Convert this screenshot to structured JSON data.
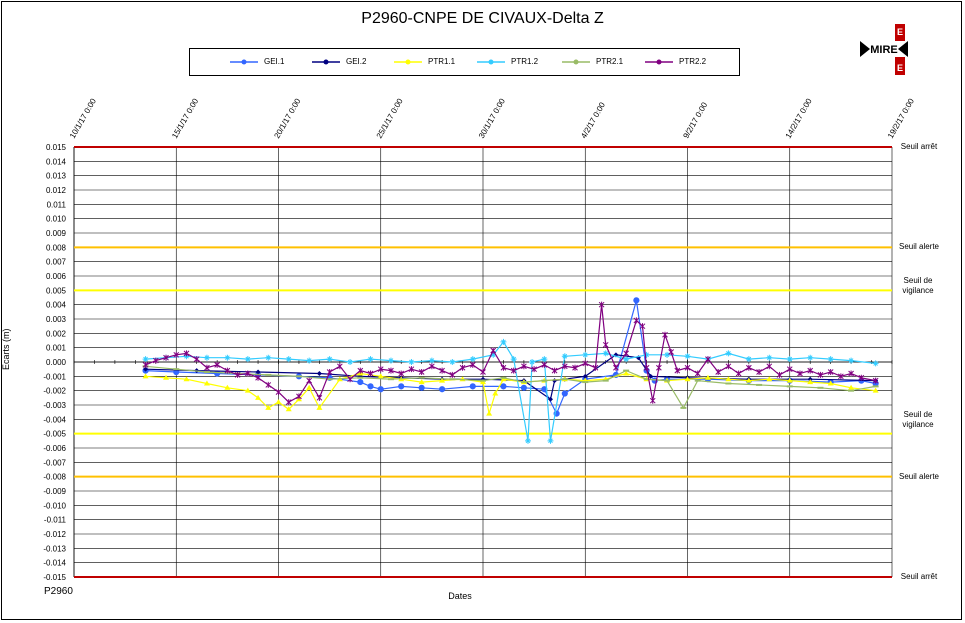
{
  "chart_data": {
    "type": "line",
    "title": "P2960-CNPE DE CIVAUX-Delta Z",
    "xlabel": "Dates",
    "ylabel": "Ecarts (m)",
    "footer": "P2960",
    "xlim": [
      "10/1/17",
      "19/2/17"
    ],
    "ylim": [
      -0.015,
      0.015
    ],
    "x_tick_labels": [
      "10/1/17 0:00",
      "15/1/17 0:00",
      "20/1/17 0:00",
      "25/1/17 0:00",
      "30/1/17 0:00",
      "4/2/17 0:00",
      "9/2/17 0:00",
      "14/2/17 0:00",
      "19/2/17 0:00"
    ],
    "y_tick_labels": [
      "0.015",
      "0.014",
      "0.013",
      "0.012",
      "0.011",
      "0.010",
      "0.009",
      "0.008",
      "0.007",
      "0.006",
      "0.005",
      "0.004",
      "0.003",
      "0.002",
      "0.001",
      "0.000",
      "-0.001",
      "-0.002",
      "-0.003",
      "-0.004",
      "-0.005",
      "-0.006",
      "-0.007",
      "-0.008",
      "-0.009",
      "-0.010",
      "-0.011",
      "-0.012",
      "-0.013",
      "-0.014",
      "-0.015"
    ],
    "grid": true,
    "legend_position": "top",
    "thresholds": [
      {
        "value": 0.015,
        "label": "Seuil arrêt",
        "color": "#c00000"
      },
      {
        "value": 0.008,
        "label": "Seuil alerte",
        "color": "#ffc000"
      },
      {
        "value": 0.005,
        "label": "Seuil de vigilance",
        "color": "#ffff00"
      },
      {
        "value": -0.005,
        "label": "Seuil de vigilance",
        "color": "#ffff00"
      },
      {
        "value": -0.008,
        "label": "Seuil alerte",
        "color": "#ffc000"
      },
      {
        "value": -0.015,
        "label": "Seuil arrêt",
        "color": "#c00000"
      }
    ],
    "series": [
      {
        "name": "GEI.1",
        "color": "#3366ff",
        "marker": "circle",
        "x": [
          13.5,
          15,
          17,
          19,
          21,
          22.5,
          24,
          24.5,
          25,
          26,
          27,
          28,
          29.5,
          31,
          32,
          33,
          33.6,
          34,
          35,
          36.5,
          37.5,
          38,
          38.4,
          39,
          41,
          43,
          45,
          47,
          48.5,
          49.2
        ],
        "y": [
          -0.0006,
          -0.0007,
          -0.0008,
          -0.0009,
          -0.001,
          -0.0011,
          -0.0014,
          -0.0017,
          -0.0019,
          -0.0017,
          -0.0018,
          -0.0019,
          -0.0017,
          -0.0017,
          -0.0018,
          -0.0019,
          -0.0036,
          -0.0022,
          -0.0012,
          -0.0009,
          0.0043,
          -0.0006,
          -0.0013,
          -0.0012,
          -0.0012,
          -0.0013,
          -0.0013,
          -0.0014,
          -0.0013,
          -0.0015
        ]
      },
      {
        "name": "GEI.2",
        "color": "#000080",
        "marker": "diamond",
        "x": [
          13.5,
          16,
          19,
          22,
          24,
          26,
          28,
          30,
          32,
          33.3,
          33.5,
          34,
          35,
          36.5,
          37.6,
          38.2,
          40,
          43,
          46,
          49.2
        ],
        "y": [
          -0.0005,
          -0.0006,
          -0.0007,
          -0.0008,
          -0.001,
          -0.0011,
          -0.0012,
          -0.0012,
          -0.0013,
          -0.0026,
          -0.0013,
          -0.0012,
          -0.001,
          0.0005,
          0.0003,
          -0.001,
          -0.0011,
          -0.0012,
          -0.0012,
          -0.0013
        ]
      },
      {
        "name": "PTR1.1",
        "color": "#ffff00",
        "marker": "triangle",
        "x": [
          13.5,
          14.5,
          15.5,
          16.5,
          17.5,
          18.5,
          19,
          19.5,
          20,
          20.5,
          21,
          21.5,
          22,
          23,
          24,
          25,
          26,
          27,
          28,
          29,
          30,
          30.3,
          30.6,
          31,
          32,
          33,
          34,
          35,
          36,
          37,
          38,
          39,
          40,
          41,
          42,
          43,
          44,
          45,
          46,
          47,
          48,
          49.2
        ],
        "y": [
          -0.001,
          -0.0011,
          -0.0012,
          -0.0015,
          -0.0018,
          -0.002,
          -0.0025,
          -0.0032,
          -0.0028,
          -0.0033,
          -0.0026,
          -0.0018,
          -0.0032,
          -0.0012,
          -0.0008,
          -0.001,
          -0.0012,
          -0.0014,
          -0.0013,
          -0.0012,
          -0.0014,
          -0.0036,
          -0.0022,
          -0.0012,
          -0.0014,
          -0.0013,
          -0.0012,
          -0.0013,
          -0.0012,
          -0.0008,
          -0.0012,
          -0.0013,
          -0.0012,
          -0.0011,
          -0.0012,
          -0.0013,
          -0.0012,
          -0.0013,
          -0.0014,
          -0.0015,
          -0.0018,
          -0.002
        ]
      },
      {
        "name": "PTR1.2",
        "color": "#33ccff",
        "marker": "star",
        "x": [
          13.5,
          14.5,
          15.5,
          16.5,
          17.5,
          18.5,
          19.5,
          20.5,
          21.5,
          22.5,
          23.5,
          24.5,
          25.5,
          26.5,
          27.5,
          28.5,
          29.5,
          30.5,
          31,
          31.5,
          32.2,
          32.4,
          33,
          33.3,
          34,
          35,
          36,
          37,
          38,
          39,
          40,
          41,
          42,
          43,
          44,
          45,
          46,
          47,
          48,
          49.2
        ],
        "y": [
          0.0002,
          0.0003,
          0.0004,
          0.0003,
          0.0003,
          0.0002,
          0.0003,
          0.0002,
          0.0001,
          0.0002,
          0.0,
          0.0002,
          0.0001,
          0.0,
          0.0001,
          0.0,
          0.0002,
          0.0005,
          0.0014,
          0.0002,
          -0.0055,
          0.0,
          0.0002,
          -0.0055,
          0.0004,
          0.0005,
          0.0006,
          0.0002,
          0.0005,
          0.0005,
          0.0004,
          0.0002,
          0.0006,
          0.0002,
          0.0003,
          0.0002,
          0.0003,
          0.0002,
          0.0001,
          -0.0001
        ]
      },
      {
        "name": "PTR2.1",
        "color": "#99bb66",
        "marker": "dash",
        "x": [
          13.5,
          15,
          16.5,
          18,
          19.5,
          21,
          22.5,
          24,
          25.5,
          27,
          28.5,
          30,
          31,
          32,
          33,
          34,
          35,
          36,
          37,
          38,
          39,
          39.8,
          40.5,
          42,
          43.5,
          45,
          46.5,
          48,
          49.2
        ],
        "y": [
          -0.0003,
          -0.0005,
          -0.0007,
          -0.0008,
          -0.0009,
          -0.001,
          -0.0012,
          -0.0011,
          -0.0012,
          -0.0011,
          -0.0012,
          -0.0013,
          -0.0011,
          -0.0014,
          -0.0013,
          -0.0012,
          -0.0014,
          -0.0013,
          -0.0006,
          -0.0012,
          -0.0013,
          -0.0032,
          -0.0013,
          -0.0015,
          -0.0016,
          -0.0017,
          -0.0018,
          -0.002,
          -0.0017
        ]
      },
      {
        "name": "PTR2.2",
        "color": "#800080",
        "marker": "x",
        "x": [
          13.5,
          14,
          14.5,
          15,
          15.5,
          16,
          16.5,
          17,
          17.5,
          18,
          18.5,
          19,
          19.5,
          20,
          20.5,
          21,
          21.5,
          22,
          22.5,
          23,
          23.5,
          24,
          24.5,
          25,
          25.5,
          26,
          26.5,
          27,
          27.5,
          28,
          28.5,
          29,
          29.5,
          30,
          30.5,
          31,
          31.5,
          32,
          32.5,
          33,
          33.5,
          34,
          34.5,
          35,
          35.5,
          35.8,
          36,
          36.5,
          37,
          37.5,
          37.8,
          38,
          38.3,
          38.6,
          38.9,
          39.2,
          39.5,
          40,
          40.5,
          41,
          41.5,
          42,
          42.5,
          43,
          43.5,
          44,
          44.5,
          45,
          45.5,
          46,
          46.5,
          47,
          47.5,
          48,
          48.5,
          49.2
        ],
        "y": [
          -0.0002,
          0.0001,
          0.0003,
          0.0005,
          0.0006,
          0.0002,
          -0.0004,
          -0.0002,
          -0.0006,
          -0.0009,
          -0.0008,
          -0.0011,
          -0.0016,
          -0.0021,
          -0.0028,
          -0.0024,
          -0.0013,
          -0.0025,
          -0.0007,
          -0.0003,
          -0.0012,
          -0.0006,
          -0.0008,
          -0.0005,
          -0.0006,
          -0.0008,
          -0.0005,
          -0.0007,
          -0.0003,
          -0.0006,
          -0.0009,
          -0.0004,
          -0.0002,
          -0.0007,
          0.0008,
          -0.0004,
          -0.0006,
          -0.0003,
          -0.0005,
          -0.0002,
          -0.0006,
          -0.0003,
          -0.0004,
          -0.0001,
          -0.0004,
          0.004,
          0.0012,
          -0.0004,
          0.0006,
          0.0029,
          0.0025,
          -0.0004,
          -0.0027,
          -0.0004,
          0.0019,
          0.0007,
          -0.0006,
          -0.0004,
          -0.0008,
          0.0002,
          -0.0007,
          -0.0003,
          -0.0008,
          -0.0004,
          -0.0007,
          -0.0003,
          -0.0009,
          -0.0005,
          -0.0008,
          -0.0006,
          -0.0009,
          -0.0007,
          -0.001,
          -0.0008,
          -0.0011,
          -0.0013
        ]
      }
    ]
  }
}
